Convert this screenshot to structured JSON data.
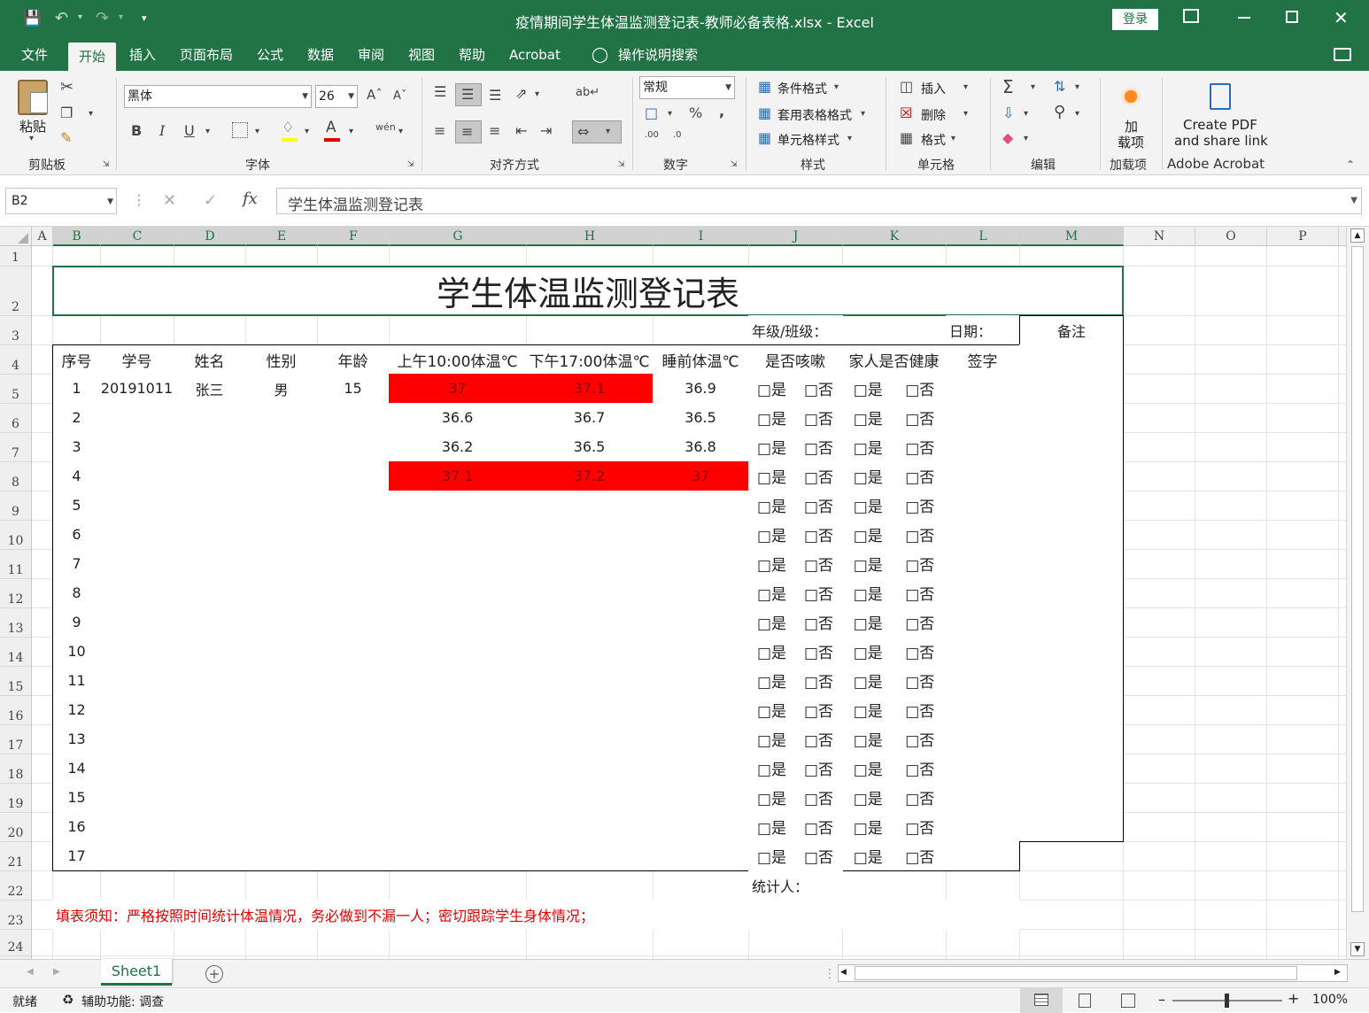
{
  "window": {
    "title": "疫情期间学生体温监测登记表-教师必备表格.xlsx  -  Excel",
    "login": "登录"
  },
  "menu": {
    "tabs": [
      "文件",
      "开始",
      "插入",
      "页面布局",
      "公式",
      "数据",
      "审阅",
      "视图",
      "帮助",
      "Acrobat"
    ],
    "active": "开始",
    "search": "操作说明搜索"
  },
  "ribbon": {
    "clipboard": {
      "paste": "粘贴",
      "label": "剪贴板"
    },
    "font": {
      "name": "黑体",
      "size": "26",
      "label": "字体",
      "bold": "B",
      "italic": "I",
      "underline": "U",
      "wen": "wén"
    },
    "alignment": {
      "label": "对齐方式"
    },
    "number": {
      "format": "常规",
      "label": "数字",
      "percent": "%",
      "comma": ",",
      "inc": ".00→.0",
      "inc1": ".00",
      "dec1": ".0"
    },
    "styles": {
      "conditional": "条件格式",
      "table": "套用表格格式",
      "cell": "单元格样式",
      "label": "样式"
    },
    "cells": {
      "insert": "插入",
      "delete": "删除",
      "format": "格式",
      "label": "单元格"
    },
    "editing": {
      "label": "编辑"
    },
    "addins": {
      "name1": "加",
      "name2": "载项",
      "label": "加载项"
    },
    "acrobat": {
      "line1": "Create PDF",
      "line2": "and share link",
      "label": "Adobe Acrobat"
    }
  },
  "formula_bar": {
    "name_box": "B2",
    "fx": "fx",
    "content": "学生体温监测登记表"
  },
  "columns": [
    "A",
    "B",
    "C",
    "D",
    "E",
    "F",
    "G",
    "H",
    "I",
    "J",
    "K",
    "L",
    "M",
    "N",
    "O",
    "P"
  ],
  "rows": [
    "1",
    "2",
    "3",
    "4",
    "5",
    "6",
    "7",
    "8",
    "9",
    "10",
    "11",
    "12",
    "13",
    "14",
    "15",
    "16",
    "17",
    "18",
    "19",
    "20",
    "21",
    "22",
    "23",
    "24"
  ],
  "sheet": {
    "title": "学生体温监测登记表",
    "grade_label": "年级/班级：",
    "date_label": "日期：",
    "remark_label": "备注",
    "headers": [
      "序号",
      "学号",
      "姓名",
      "性别",
      "年龄",
      "上午10:00体温℃",
      "下午17:00体温℃",
      "睡前体温℃",
      "是否咳嗽",
      "家人是否健康",
      "签字"
    ],
    "checkbox_yes": "□是",
    "checkbox_no": "□否",
    "records": [
      {
        "no": "1",
        "id": "20191011",
        "name": "张三",
        "gender": "男",
        "age": "15",
        "am": "37",
        "pm": "37.1",
        "night": "36.9",
        "alert": [
          true,
          true,
          false
        ]
      },
      {
        "no": "2",
        "id": "",
        "name": "",
        "gender": "",
        "age": "",
        "am": "36.6",
        "pm": "36.7",
        "night": "36.5",
        "alert": [
          false,
          false,
          false
        ]
      },
      {
        "no": "3",
        "id": "",
        "name": "",
        "gender": "",
        "age": "",
        "am": "36.2",
        "pm": "36.5",
        "night": "36.8",
        "alert": [
          false,
          false,
          false
        ]
      },
      {
        "no": "4",
        "id": "",
        "name": "",
        "gender": "",
        "age": "",
        "am": "37.1",
        "pm": "37.2",
        "night": "37",
        "alert": [
          true,
          true,
          true
        ]
      },
      {
        "no": "5"
      },
      {
        "no": "6"
      },
      {
        "no": "7"
      },
      {
        "no": "8"
      },
      {
        "no": "9"
      },
      {
        "no": "10"
      },
      {
        "no": "11"
      },
      {
        "no": "12"
      },
      {
        "no": "13"
      },
      {
        "no": "14"
      },
      {
        "no": "15"
      },
      {
        "no": "16"
      },
      {
        "no": "17"
      }
    ],
    "statistician_label": "统计人：",
    "notice": "填表须知：严格按照时间统计体温情况，务必做到不漏一人；密切跟踪学生身体情况；"
  },
  "sheet_tabs": {
    "active": "Sheet1"
  },
  "status": {
    "ready": "就绪",
    "accessibility": "辅助功能: 调查",
    "zoom": "100%"
  },
  "colors": {
    "excel_green": "#217346",
    "alert_red": "#ff0000",
    "notice_red": "#e00000"
  }
}
